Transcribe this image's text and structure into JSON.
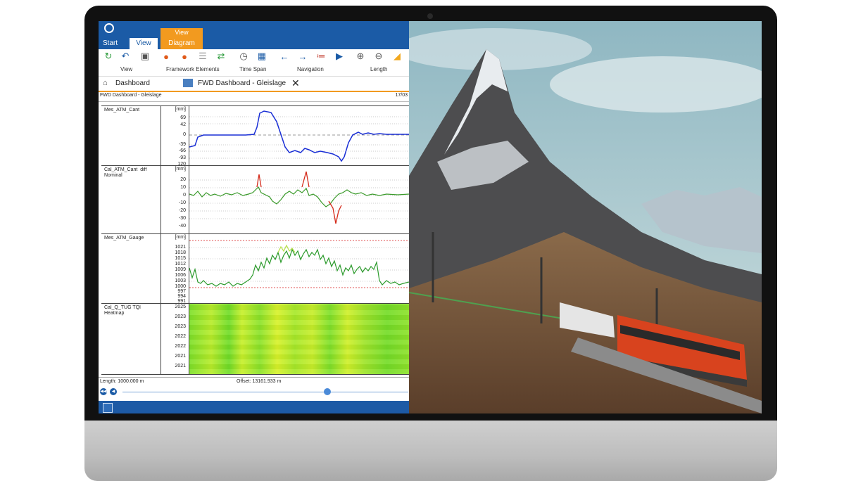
{
  "ribbon_tabs": {
    "start": "Start",
    "view": "View",
    "context_group": "View",
    "diagram": "Diagram"
  },
  "ribbon_groups": {
    "view": "View",
    "framework": "Framework Elements",
    "timespan": "Time Span",
    "navigation": "Navigation",
    "length": "Length"
  },
  "nav": {
    "dashboard": "Dashboard",
    "doc_tab": "FWD Dashboard - Gleislage"
  },
  "breadcrumb": {
    "title": "FWD Dashboard - Gleislage",
    "date": "17/03"
  },
  "panels": [
    {
      "label": "Mes_ATM_Cant",
      "unit": "[mm]",
      "ticks": [
        "69",
        "42",
        "0",
        "-39",
        "-66",
        "-93",
        "120"
      ]
    },
    {
      "label": "Cal_ATM_Cant  diff\nNominal",
      "unit": "[mm]",
      "ticks": [
        "20",
        "10",
        "0",
        "-10",
        "-20",
        "-30",
        "-40"
      ]
    },
    {
      "label": "Mes_ATM_Gauge",
      "unit": "[mm]",
      "ticks": [
        "1021",
        "1018",
        "1015",
        "1012",
        "1009",
        "1006",
        "1003",
        "1000",
        "997",
        "994",
        "991"
      ]
    },
    {
      "label": "Cal_Q_TUG TQI\nHeatmap",
      "unit": "",
      "ticks": [
        "2025",
        "2023",
        "2023",
        "2022",
        "2022",
        "2021",
        "2021"
      ]
    }
  ],
  "status": {
    "length": "Length: 1000.000 m",
    "offset": "Offset: 13161.933 m"
  },
  "colors": {
    "brand_blue": "#1b5ba6",
    "accent_orange": "#f29a1f",
    "cant_line": "#1a2fd6",
    "diff_line": "#3a9a2a",
    "gauge_line": "#2b9a2b"
  }
}
